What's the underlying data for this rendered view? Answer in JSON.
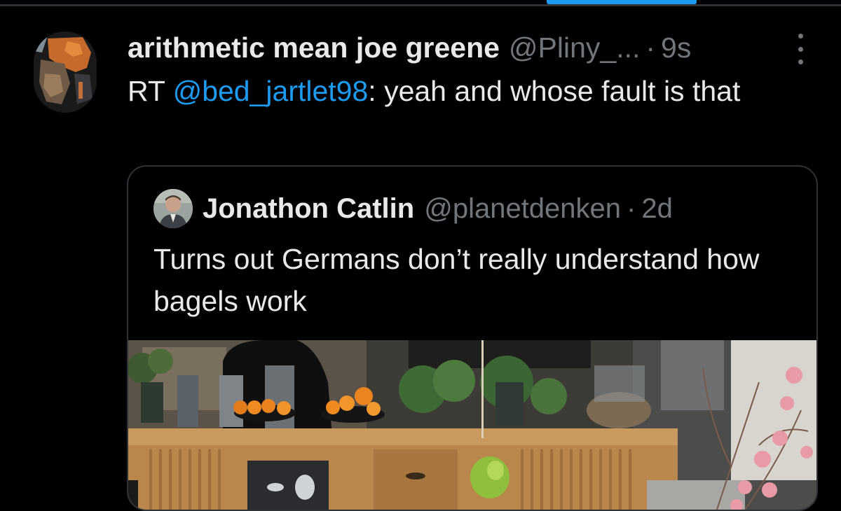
{
  "tweet": {
    "author_name": "arithmetic mean joe greene",
    "author_handle": "@Pliny_...",
    "separator": "·",
    "time": "9s",
    "rt_prefix": "RT",
    "mention": "@bed_jartlet98",
    "text": ": yeah and whose fault is that"
  },
  "quoted_tweet": {
    "author_name": "Jonathon Catlin",
    "author_handle": "@planetdenken",
    "separator": "·",
    "time": "2d",
    "text": "Turns out Germans don’t really understand how bagels work"
  },
  "icons": {
    "more": "more-options-icon"
  },
  "colors": {
    "background": "#000000",
    "text": "#e7e9ea",
    "secondary_text": "#71767b",
    "link": "#1d9bf0",
    "border": "#2f3336"
  }
}
